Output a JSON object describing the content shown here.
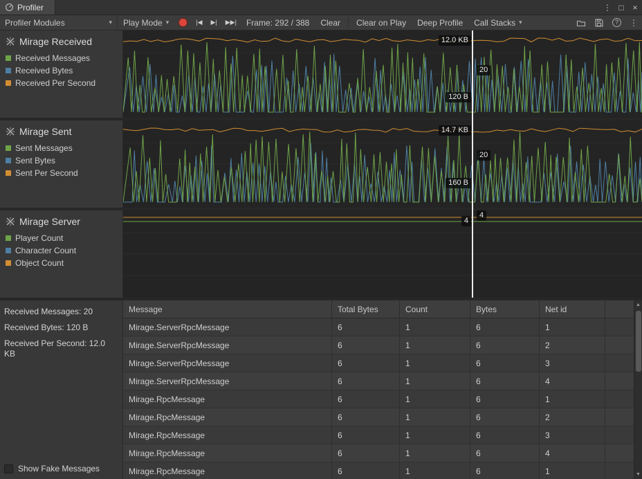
{
  "window": {
    "title": "Profiler"
  },
  "icons": {
    "dropdown": "▾",
    "jump_back": "|◀",
    "step_forward": "▶|",
    "jump_current": "▶▶|",
    "window_menu": "⋮",
    "window_maximize": "□",
    "window_close": "×",
    "toolbar_more": "⋮",
    "help": "?",
    "scroll_up": "▲",
    "scroll_down": "▼"
  },
  "toolbar": {
    "profiler_modules": "Profiler Modules",
    "play_mode": "Play Mode",
    "frame": "Frame: 292 / 388",
    "clear": "Clear",
    "clear_on_play": "Clear on Play",
    "deep_profile": "Deep Profile",
    "call_stacks": "Call Stacks"
  },
  "modules": [
    {
      "title": "Mirage Received",
      "legend": [
        {
          "label": "Received Messages",
          "color": "#6fa348"
        },
        {
          "label": "Received Bytes",
          "color": "#4e7fa3"
        },
        {
          "label": "Received Per Second",
          "color": "#d28e33"
        }
      ],
      "markers": [
        {
          "text": "12.0 KB",
          "side": "left",
          "y": 14
        },
        {
          "text": "20",
          "side": "right",
          "y": 57
        },
        {
          "text": "120 B",
          "side": "left",
          "y": 96
        }
      ],
      "chart": {
        "style": "spiky",
        "seed": 42
      }
    },
    {
      "title": "Mirage Sent",
      "legend": [
        {
          "label": "Sent Messages",
          "color": "#6fa348"
        },
        {
          "label": "Sent Bytes",
          "color": "#4e7fa3"
        },
        {
          "label": "Sent Per Second",
          "color": "#d28e33"
        }
      ],
      "markers": [
        {
          "text": "14.7 KB",
          "side": "left",
          "y": 14
        },
        {
          "text": "20",
          "side": "right",
          "y": 50
        },
        {
          "text": "160 B",
          "side": "left",
          "y": 90
        }
      ],
      "chart": {
        "style": "spiky",
        "seed": 77
      }
    },
    {
      "title": "Mirage Server",
      "legend": [
        {
          "label": "Player Count",
          "color": "#6fa348"
        },
        {
          "label": "Character Count",
          "color": "#4e7fa3"
        },
        {
          "label": "Object Count",
          "color": "#d28e33"
        }
      ],
      "markers": [
        {
          "text": "4",
          "side": "right",
          "y": 7
        },
        {
          "text": "4",
          "side": "left",
          "y": 15
        }
      ],
      "chart": {
        "style": "flat",
        "lines": [
          {
            "series": 2,
            "y": 10
          },
          {
            "series": 0,
            "y": 16
          }
        ]
      }
    }
  ],
  "stats": [
    "Received Messages: 20",
    "Received Bytes: 120 B",
    "Received Per Second: 12.0 KB"
  ],
  "show_fake_label": "Show Fake Messages",
  "table": {
    "columns": [
      "Message",
      "Total Bytes",
      "Count",
      "Bytes",
      "Net id"
    ],
    "rows": [
      [
        "Mirage.ServerRpcMessage",
        "6",
        "1",
        "6",
        "1"
      ],
      [
        "Mirage.ServerRpcMessage",
        "6",
        "1",
        "6",
        "2"
      ],
      [
        "Mirage.ServerRpcMessage",
        "6",
        "1",
        "6",
        "3"
      ],
      [
        "Mirage.ServerRpcMessage",
        "6",
        "1",
        "6",
        "4"
      ],
      [
        "Mirage.RpcMessage",
        "6",
        "1",
        "6",
        "1"
      ],
      [
        "Mirage.RpcMessage",
        "6",
        "1",
        "6",
        "2"
      ],
      [
        "Mirage.RpcMessage",
        "6",
        "1",
        "6",
        "3"
      ],
      [
        "Mirage.RpcMessage",
        "6",
        "1",
        "6",
        "4"
      ],
      [
        "Mirage.RpcMessage",
        "6",
        "1",
        "6",
        "1"
      ]
    ]
  },
  "colors": {
    "green": "#6fa348",
    "blue": "#4e7fa3",
    "orange": "#d28e33",
    "frame_line": "#ececec"
  }
}
